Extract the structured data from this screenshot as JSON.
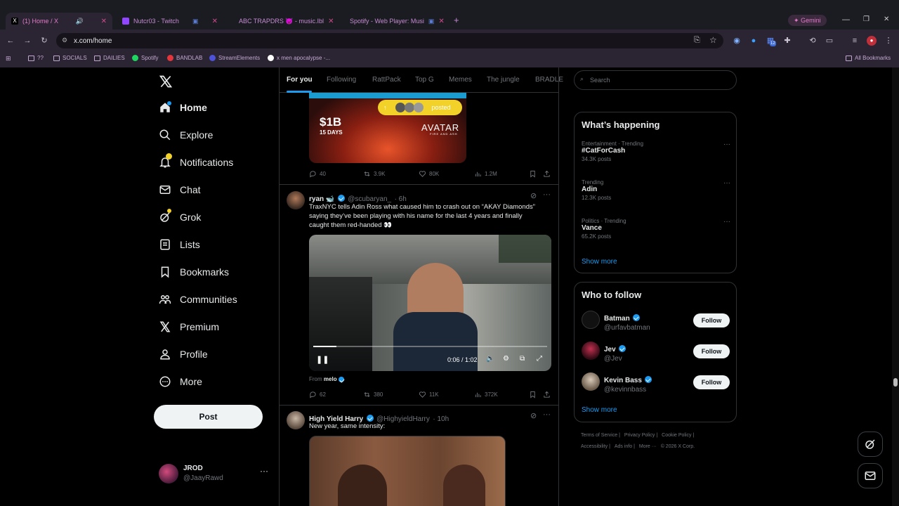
{
  "browser": {
    "tabs": [
      {
        "label": "(1) Home / X",
        "active": true
      },
      {
        "label": "Nutcr03 - Twitch",
        "active": false
      },
      {
        "label": "ABC TRAPDRS 👿 - music.Ibl",
        "active": false
      },
      {
        "label": "Spotify - Web Player: Musi",
        "active": false
      }
    ],
    "gemini_label": "Gemini",
    "url": "x.com/home",
    "extension_badge": "12",
    "bookmarks": [
      "??",
      "SOCIALS",
      "DAILIES",
      "Spotify",
      "BANDLAB",
      "StreamElements",
      "x men apocalypse -..."
    ],
    "all_bookmarks": "All Bookmarks"
  },
  "sidebar": {
    "items": [
      {
        "label": "Home",
        "icon": "home-icon"
      },
      {
        "label": "Explore",
        "icon": "search-icon"
      },
      {
        "label": "Notifications",
        "icon": "bell-icon"
      },
      {
        "label": "Chat",
        "icon": "mail-icon"
      },
      {
        "label": "Grok",
        "icon": "grok-icon"
      },
      {
        "label": "Lists",
        "icon": "list-icon"
      },
      {
        "label": "Bookmarks",
        "icon": "bookmark-icon"
      },
      {
        "label": "Communities",
        "icon": "communities-icon"
      },
      {
        "label": "Premium",
        "icon": "x-logo-icon"
      },
      {
        "label": "Profile",
        "icon": "person-icon"
      },
      {
        "label": "More",
        "icon": "more-circle-icon"
      }
    ],
    "post_label": "Post",
    "account": {
      "name": "JROD",
      "handle": "@JaayRawd"
    }
  },
  "feed": {
    "tabs": [
      "For you",
      "Following",
      "RattPack",
      "Top G",
      "Memes",
      "The jungle",
      "BRADLE"
    ],
    "post0": {
      "media_text": {
        "amount": "$1B",
        "days": "15 DAYS",
        "brand": "AVATAR",
        "brand_sub": "FIRE AND ASH",
        "posted_pill": "posted"
      },
      "replies": "40",
      "reposts": "3.9K",
      "likes": "80K",
      "views": "1.2M"
    },
    "post1": {
      "name": "ryan 🐋",
      "handle": "@scubaryan_",
      "time": "· 6h",
      "text_line1": "TraxNYC tells Adin Ross what caused him to crash out on “AKAY Diamonds”",
      "text_line2": "saying they’ve been playing with his name for the last 4 years and finally",
      "text_line3": "caught them red-handed 👀",
      "video_time": "0:06 / 1:02",
      "video_progress": 0.1,
      "from_label": "From",
      "from_name": "melo",
      "replies": "62",
      "reposts": "380",
      "likes": "11K",
      "views": "372K"
    },
    "post2": {
      "name": "High Yield Harry",
      "handle": "@HighyieldHarry",
      "time": "· 10h",
      "text": "New year, same intensity:"
    }
  },
  "right": {
    "search_placeholder": "Search",
    "happening_title": "What’s happening",
    "trends": [
      {
        "meta": "Entertainment · Trending",
        "name": "#CatForCash",
        "posts": "34.3K posts"
      },
      {
        "meta": "Trending",
        "name": "Adin",
        "posts": "12.3K posts"
      },
      {
        "meta": "Politics · Trending",
        "name": "Vance",
        "posts": "65.2K posts"
      }
    ],
    "show_more": "Show more",
    "who_title": "Who to follow",
    "follow": [
      {
        "name": "Batman",
        "handle": "@urfavbatman"
      },
      {
        "name": "Jev",
        "handle": "@Jev"
      },
      {
        "name": "Kevin Bass",
        "handle": "@kevinnbass"
      }
    ],
    "follow_label": "Follow",
    "footer": [
      "Terms of Service",
      "Privacy Policy",
      "Cookie Policy",
      "Accessibility",
      "Ads info",
      "More ···",
      "© 2026 X Corp."
    ]
  }
}
